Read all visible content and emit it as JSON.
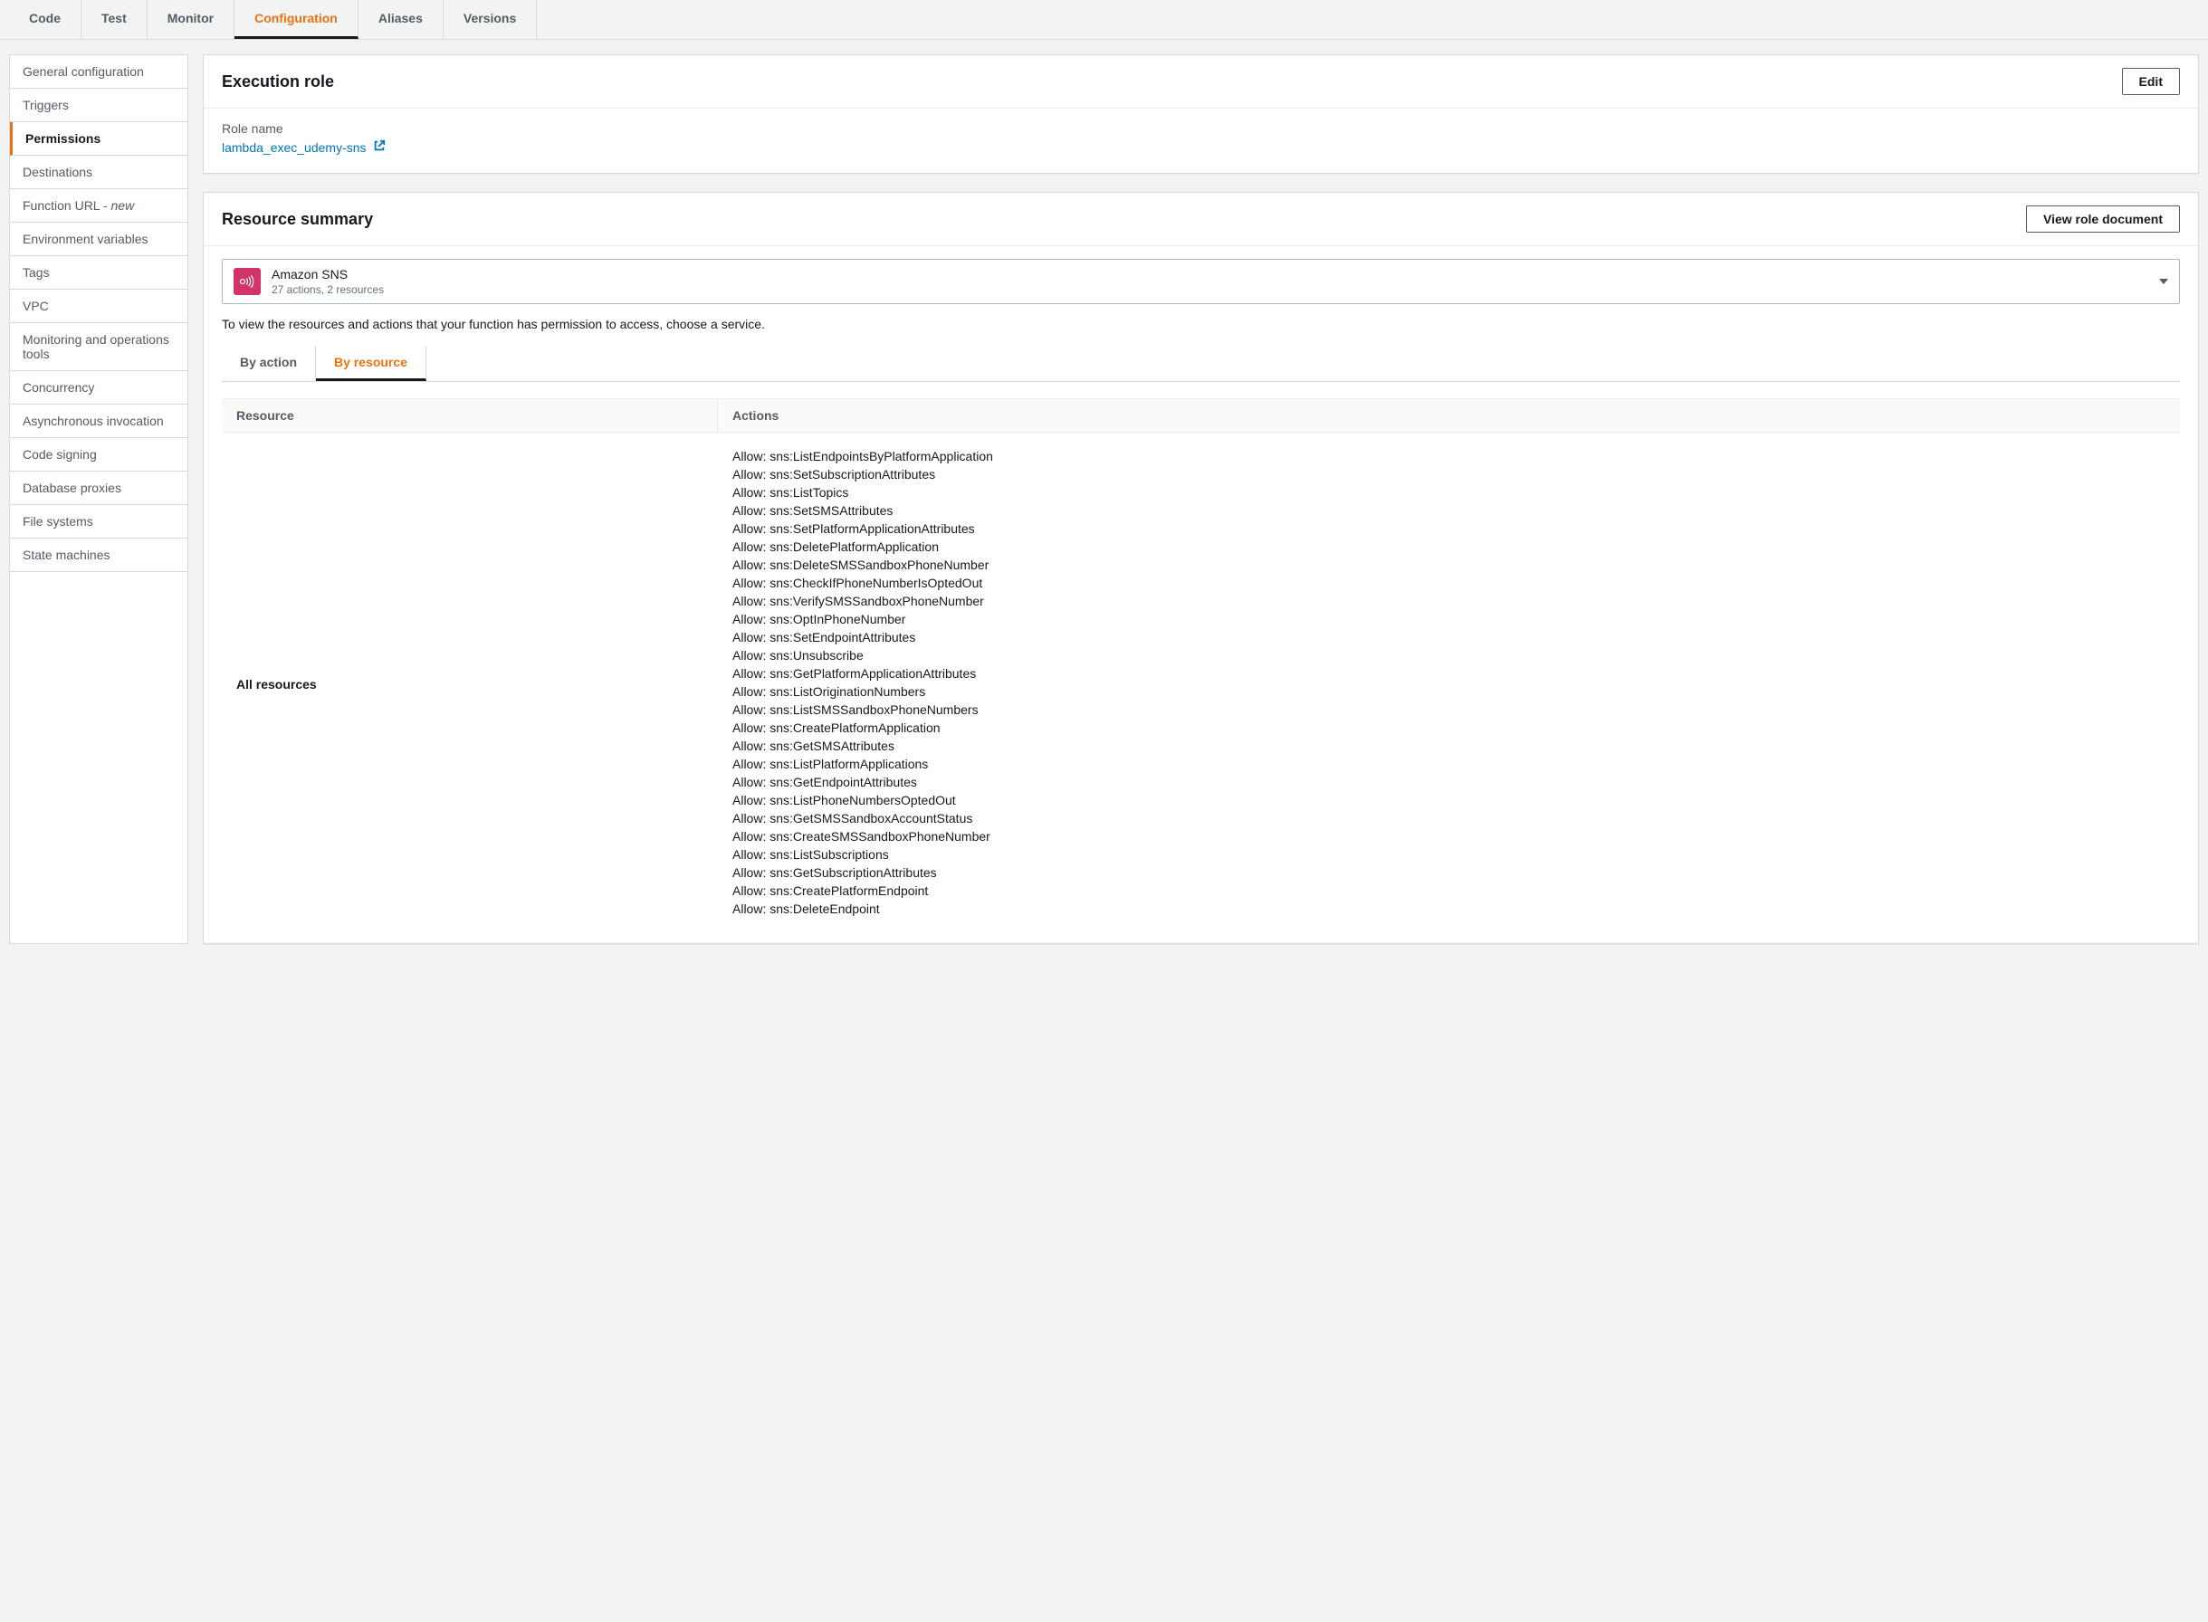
{
  "tabs": [
    "Code",
    "Test",
    "Monitor",
    "Configuration",
    "Aliases",
    "Versions"
  ],
  "active_tab": "Configuration",
  "sidebar": {
    "items": [
      "General configuration",
      "Triggers",
      "Permissions",
      "Destinations",
      "Function URL - ",
      "Environment variables",
      "Tags",
      "VPC",
      "Monitoring and operations tools",
      "Concurrency",
      "Asynchronous invocation",
      "Code signing",
      "Database proxies",
      "File systems",
      "State machines"
    ],
    "new_suffix": "new",
    "active": "Permissions"
  },
  "execution_role": {
    "title": "Execution role",
    "edit_label": "Edit",
    "role_name_label": "Role name",
    "role_name_value": "lambda_exec_udemy-sns"
  },
  "resource_summary": {
    "title": "Resource summary",
    "view_doc_label": "View role document",
    "service": {
      "name": "Amazon SNS",
      "sub": "27 actions, 2 resources"
    },
    "help_text": "To view the resources and actions that your function has permission to access, choose a service.",
    "sub_tabs": [
      "By action",
      "By resource"
    ],
    "active_sub_tab": "By resource",
    "table": {
      "col_resource": "Resource",
      "col_actions": "Actions",
      "resource_label": "All resources",
      "actions": [
        "Allow: sns:ListEndpointsByPlatformApplication",
        "Allow: sns:SetSubscriptionAttributes",
        "Allow: sns:ListTopics",
        "Allow: sns:SetSMSAttributes",
        "Allow: sns:SetPlatformApplicationAttributes",
        "Allow: sns:DeletePlatformApplication",
        "Allow: sns:DeleteSMSSandboxPhoneNumber",
        "Allow: sns:CheckIfPhoneNumberIsOptedOut",
        "Allow: sns:VerifySMSSandboxPhoneNumber",
        "Allow: sns:OptInPhoneNumber",
        "Allow: sns:SetEndpointAttributes",
        "Allow: sns:Unsubscribe",
        "Allow: sns:GetPlatformApplicationAttributes",
        "Allow: sns:ListOriginationNumbers",
        "Allow: sns:ListSMSSandboxPhoneNumbers",
        "Allow: sns:CreatePlatformApplication",
        "Allow: sns:GetSMSAttributes",
        "Allow: sns:ListPlatformApplications",
        "Allow: sns:GetEndpointAttributes",
        "Allow: sns:ListPhoneNumbersOptedOut",
        "Allow: sns:GetSMSSandboxAccountStatus",
        "Allow: sns:CreateSMSSandboxPhoneNumber",
        "Allow: sns:ListSubscriptions",
        "Allow: sns:GetSubscriptionAttributes",
        "Allow: sns:CreatePlatformEndpoint",
        "Allow: sns:DeleteEndpoint"
      ]
    }
  }
}
